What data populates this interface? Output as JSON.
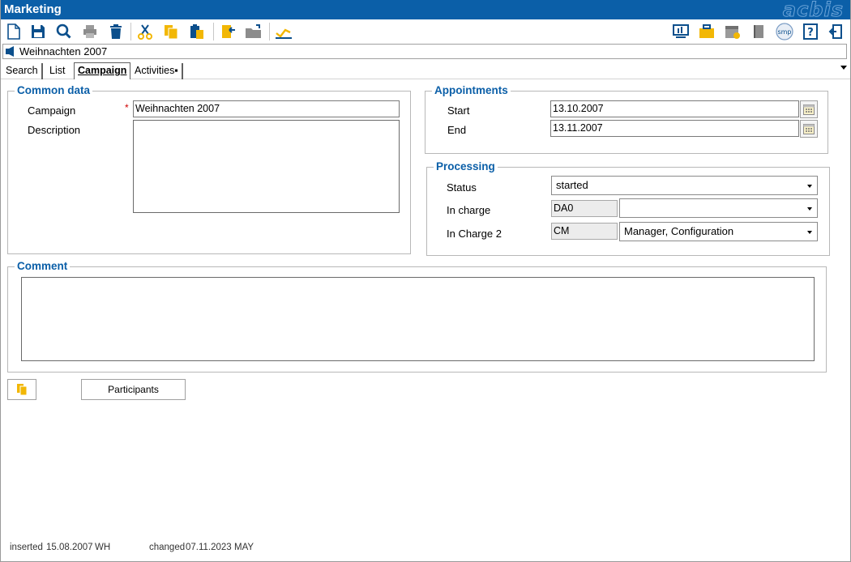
{
  "window": {
    "title": "Marketing",
    "logo_text": "acbis"
  },
  "record": {
    "title": "Weihnachten 2007"
  },
  "tabs": [
    {
      "label": "Search"
    },
    {
      "label": "List"
    },
    {
      "label": "Campaign"
    },
    {
      "label": "Activities▪"
    }
  ],
  "common_data": {
    "legend": "Common data",
    "campaign_label": "Campaign",
    "campaign_value": "Weihnachten 2007",
    "description_label": "Description",
    "description_value": ""
  },
  "appointments": {
    "legend": "Appointments",
    "start_label": "Start",
    "start_value": "13.10.2007",
    "end_label": "End",
    "end_value": "13.11.2007"
  },
  "processing": {
    "legend": "Processing",
    "status_label": "Status",
    "status_value": "started",
    "in_charge_label": "In charge",
    "in_charge_code": "DA0",
    "in_charge_name": "",
    "in_charge2_label": "In Charge 2",
    "in_charge2_code": "CM",
    "in_charge2_name": "Manager, Configuration"
  },
  "comment": {
    "legend": "Comment",
    "value": ""
  },
  "buttons": {
    "participants": "Participants"
  },
  "status_bar": {
    "inserted_label": "inserted",
    "inserted_date": "15.08.2007",
    "inserted_user": "WH",
    "changed_label": "changed",
    "changed_date": "07.11.2023",
    "changed_user": "MAY"
  },
  "colors": {
    "titlebar": "#0b5fa8",
    "legend": "#0b5fa8",
    "toolbar_yellow": "#f2b705",
    "toolbar_blue": "#0b4f8c"
  },
  "icons": [
    "new-document-icon",
    "save-icon",
    "search-icon",
    "print-icon",
    "delete-icon",
    "cut-icon",
    "copy-icon",
    "paste-icon",
    "import-icon",
    "open-folder-icon",
    "chart-icon",
    "monitor-icon",
    "briefcase-icon",
    "calendar-check-icon",
    "book-icon",
    "smp-icon",
    "help-icon",
    "exit-icon"
  ]
}
